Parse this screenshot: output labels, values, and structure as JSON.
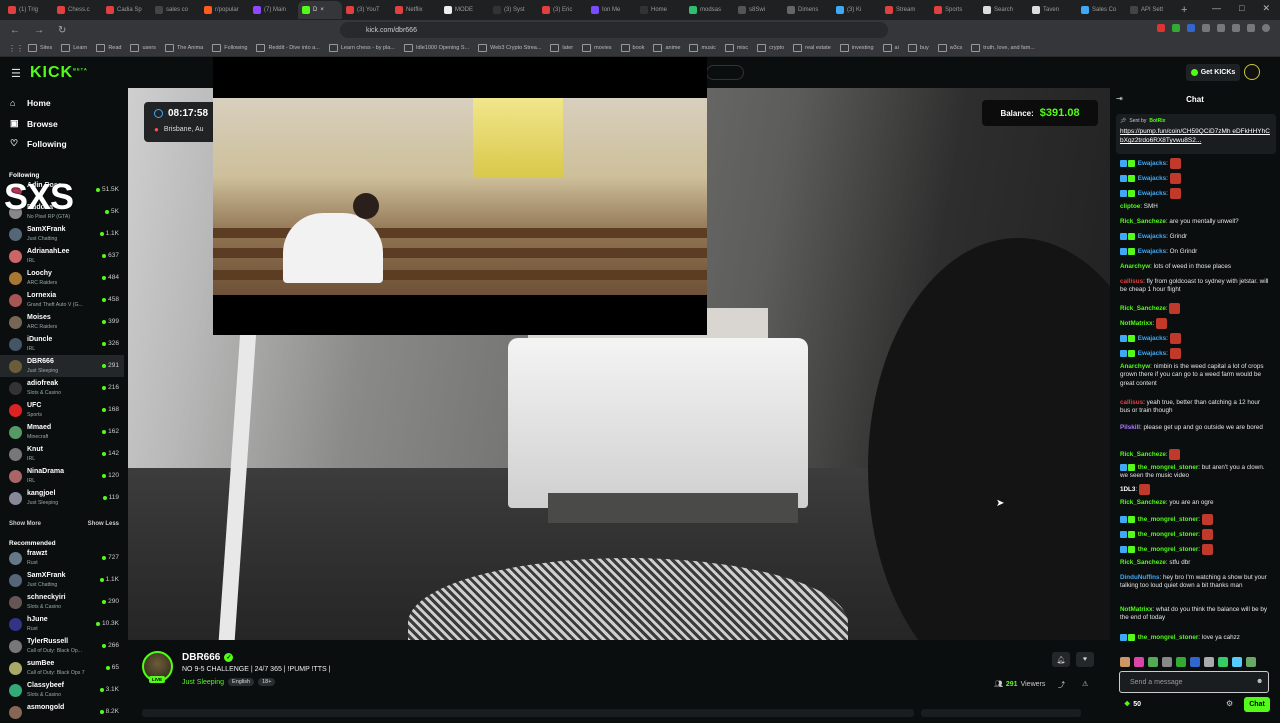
{
  "browser": {
    "tabs": [
      {
        "label": "(1) Trig",
        "color": "#e04040"
      },
      {
        "label": "Chess.c",
        "color": "#e04040"
      },
      {
        "label": "Cadia Sp",
        "color": "#e04040"
      },
      {
        "label": "sales co",
        "color": "#444"
      },
      {
        "label": "r/popular",
        "color": "#ff5a1f"
      },
      {
        "label": "(7) Main",
        "color": "#9146ff"
      },
      {
        "label": "D",
        "color": "#53fc18",
        "active": true
      },
      {
        "label": "(3) YouT",
        "color": "#e04040"
      },
      {
        "label": "Netflix",
        "color": "#e04040"
      },
      {
        "label": "MODE",
        "color": "#eee"
      },
      {
        "label": "(3) Syst",
        "color": "#333"
      },
      {
        "label": "(3) Eric",
        "color": "#e04040"
      },
      {
        "label": "Ion Me",
        "color": "#7a4cff"
      },
      {
        "label": "Home",
        "color": "#333"
      },
      {
        "label": "modsas",
        "color": "#2cc070"
      },
      {
        "label": "s8Swi",
        "color": "#555"
      },
      {
        "label": "Dimens",
        "color": "#666"
      },
      {
        "label": "(3) Ki",
        "color": "#3fa9f5"
      },
      {
        "label": "Stream",
        "color": "#e04040"
      },
      {
        "label": "Sports",
        "color": "#e04040"
      },
      {
        "label": "Search",
        "color": "#ddd"
      },
      {
        "label": "Taven",
        "color": "#ddd"
      },
      {
        "label": "Sales Co",
        "color": "#3fa9f5"
      },
      {
        "label": "API Sett",
        "color": "#444"
      }
    ],
    "new_tab": "+",
    "window_controls": [
      "—",
      "□",
      "✕"
    ],
    "address": "kick.com/dbr666",
    "bookmarks": [
      "Sites",
      "Learn",
      "Read",
      "users",
      "The Anima",
      "Following",
      "Reddit - Dive into a...",
      "Learn chess - by pla...",
      "Idle1000 Opening S...",
      "Web3 Crypto Strea...",
      "later",
      "movies",
      "book",
      "anime",
      "music",
      "misc",
      "crypto",
      "real estate",
      "investing",
      "ai",
      "buy",
      "w3cs",
      "truth, love, and fam..."
    ]
  },
  "header": {
    "logo": "KICK",
    "logo_sup": "BETA",
    "get_kicks": "Get KICKs"
  },
  "sidebar": {
    "nav": [
      {
        "label": "Home",
        "icon": "⌂"
      },
      {
        "label": "Browse",
        "icon": "▣"
      },
      {
        "label": "Following",
        "icon": "♡"
      }
    ],
    "following_title": "Following",
    "following": [
      {
        "name": "Adin Ross",
        "cat": "",
        "viewers": "51.5K",
        "color": "#b35"
      },
      {
        "name": "Buddha",
        "cat": "No Pixel RP (GTA)",
        "viewers": "5K",
        "color": "#888"
      },
      {
        "name": "SamXFrank",
        "cat": "Just Chatting",
        "viewers": "1.1K",
        "color": "#567"
      },
      {
        "name": "AdrianahLee",
        "cat": "IRL",
        "viewers": "637",
        "color": "#c66"
      },
      {
        "name": "Loochy",
        "cat": "ARC Raiders",
        "viewers": "484",
        "color": "#a73"
      },
      {
        "name": "Lornexia",
        "cat": "Grand Theft Auto V (G...",
        "viewers": "458",
        "color": "#a55"
      },
      {
        "name": "Moises",
        "cat": "ARC Raiders",
        "viewers": "399",
        "color": "#765"
      },
      {
        "name": "iDuncle",
        "cat": "IRL",
        "viewers": "326",
        "color": "#456"
      },
      {
        "name": "DBR666",
        "cat": "Just Sleeping",
        "viewers": "291",
        "color": "#6b5c3a",
        "selected": true
      },
      {
        "name": "adiofreak",
        "cat": "Slots & Casino",
        "viewers": "216",
        "color": "#333"
      },
      {
        "name": "UFC",
        "cat": "Sports",
        "viewers": "168",
        "color": "#d22"
      },
      {
        "name": "Mmaed",
        "cat": "Minecraft",
        "viewers": "162",
        "color": "#596"
      },
      {
        "name": "Knut",
        "cat": "IRL",
        "viewers": "142",
        "color": "#777"
      },
      {
        "name": "NinaDrama",
        "cat": "IRL",
        "viewers": "120",
        "color": "#a66"
      },
      {
        "name": "kangjoel",
        "cat": "Just Sleeping",
        "viewers": "119",
        "color": "#889"
      }
    ],
    "show_more": "Show More",
    "show_less": "Show Less",
    "recommended_title": "Recommended",
    "recommended": [
      {
        "name": "frawzt",
        "cat": "Rust",
        "viewers": "727",
        "color": "#678"
      },
      {
        "name": "SamXFrank",
        "cat": "Just Chatting",
        "viewers": "1.1K",
        "color": "#567"
      },
      {
        "name": "schneckyiri",
        "cat": "Slots & Casino",
        "viewers": "290",
        "color": "#655"
      },
      {
        "name": "hJune",
        "cat": "Rust",
        "viewers": "10.3K",
        "color": "#338"
      },
      {
        "name": "TylerRussell",
        "cat": "Call of Duty: Black Op...",
        "viewers": "266",
        "color": "#777"
      },
      {
        "name": "sumBee",
        "cat": "Call of Duty: Black Ops 7",
        "viewers": "65",
        "color": "#aa6"
      },
      {
        "name": "Classybeef",
        "cat": "Slots & Casino",
        "viewers": "3.1K",
        "color": "#3a7"
      },
      {
        "name": "asmongold",
        "cat": "",
        "viewers": "8.2K",
        "color": "#865"
      }
    ]
  },
  "overlay": {
    "time": "08:17:58",
    "location": "Brisbane, Au",
    "balance_label": "Balance:",
    "balance_value": "$391.08",
    "watermark": "SXS"
  },
  "channel": {
    "name": "DBR666",
    "live": "LIVE",
    "title": "NO 9-5 CHALLENGE | 24/7 365 | !PUMP !TTS |",
    "category": "Just Sleeping",
    "tags": [
      "English",
      "18+"
    ],
    "viewers_count": "291",
    "viewers_label": "Viewers"
  },
  "chat": {
    "title": "Chat",
    "pinned_by_label": "Sent by",
    "pinned_by": "BotRix",
    "pinned_url": "https://pump.fun/coin/CH59QCiD7zMh eDFkHHYhCbXgz2trdo6RX8Tyvwu8S2...",
    "messages": [
      {
        "user": "Ewajacks",
        "text": ":",
        "color": "#3fa9f5",
        "badges": true,
        "emote": true
      },
      {
        "user": "Ewajacks",
        "text": ":",
        "color": "#3fa9f5",
        "badges": true,
        "emote": true
      },
      {
        "user": "Ewajacks",
        "text": ":",
        "color": "#3fa9f5",
        "badges": true,
        "emote": true
      },
      {
        "user": "cliptoe",
        "text": ": SMH",
        "color": "#53fc18"
      },
      {
        "user": "Rick_Sancheze",
        "text": ": are you mentally unwell?",
        "color": "#53fc18"
      },
      {
        "user": "Ewajacks",
        "text": ": Grindr",
        "color": "#3fa9f5",
        "badges": true
      },
      {
        "user": "Ewajacks",
        "text": ": On Grindr",
        "color": "#3fa9f5",
        "badges": true
      },
      {
        "user": "Anarchyw",
        "text": ": lots of weed in those places",
        "color": "#53fc18"
      },
      {
        "user": "callisus",
        "text": ": fly from goldcoast to sydney with jetstar. will be cheap 1 hour flight",
        "color": "#e04040"
      },
      {
        "user": "Rick_Sancheze",
        "text": ":",
        "color": "#53fc18",
        "emote": true
      },
      {
        "user": "NotMatrixx",
        "text": ":",
        "color": "#53fc18",
        "emote": true
      },
      {
        "user": "Ewajacks",
        "text": ":",
        "color": "#3fa9f5",
        "badges": true,
        "emote": true
      },
      {
        "user": "Ewajacks",
        "text": ":",
        "color": "#3fa9f5",
        "badges": true,
        "emote": true
      },
      {
        "user": "Anarchyw",
        "text": ": nimbin is the weed capital a lot of crops grown there if you can go to a weed farm would be great content",
        "color": "#53fc18"
      },
      {
        "user": "callisus",
        "text": ": yeah true, better than catching a 12 hour bus or train though",
        "color": "#e04040"
      },
      {
        "user": "Pilskill",
        "text": ": please get up and go outside we are bored",
        "color": "#b07cff"
      },
      {
        "user": "Rick_Sancheze",
        "text": ":",
        "color": "#53fc18",
        "emote": true
      },
      {
        "user": "the_mongrel_stoner",
        "text": ": but aren't you a clown. we seen the music video",
        "color": "#53fc18",
        "badges": true
      },
      {
        "user": "1DL3",
        "text": ":",
        "color": "#fff",
        "emote": true
      },
      {
        "user": "Rick_Sancheze",
        "text": ": you are an ogre",
        "color": "#53fc18"
      },
      {
        "user": "the_mongrel_stoner",
        "text": ":",
        "color": "#53fc18",
        "badges": true,
        "emote": true
      },
      {
        "user": "the_mongrel_stoner",
        "text": ":",
        "color": "#53fc18",
        "badges": true,
        "emote": true
      },
      {
        "user": "the_mongrel_stoner",
        "text": ":",
        "color": "#53fc18",
        "badges": true,
        "emote": true
      },
      {
        "user": "Rick_Sancheze",
        "text": ": stfu dbr",
        "color": "#53fc18"
      },
      {
        "user": "DinduNuffins",
        "text": ": hey bro I'm watching a show but your talking too loud quiet down a bit thanks man",
        "color": "#3fa9f5"
      },
      {
        "user": "NotMatrixx",
        "text": ": what do you think the balance will be by the end of today",
        "color": "#53fc18"
      },
      {
        "user": "the_mongrel_stoner",
        "text": ": love ya cahzz",
        "color": "#53fc18",
        "badges": true
      }
    ],
    "input_placeholder": "Send a message",
    "kicks": "50",
    "send": "Chat"
  },
  "colors": {
    "accent": "#53fc18",
    "bg": "#0b0e0f"
  }
}
